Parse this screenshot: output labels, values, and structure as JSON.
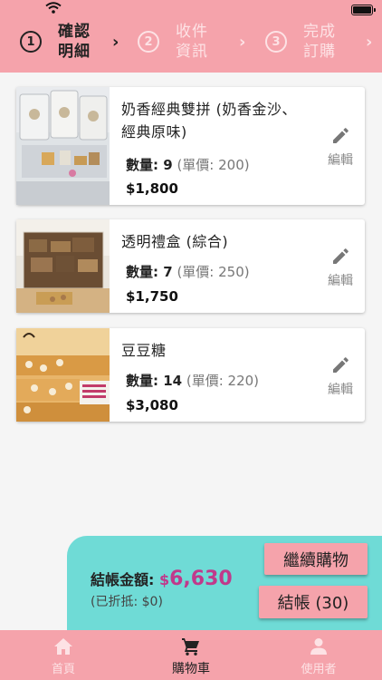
{
  "stepper": {
    "steps": [
      {
        "number": "1",
        "label": "確認\n明細",
        "active": true
      },
      {
        "number": "2",
        "label": "收件\n資訊",
        "active": false
      },
      {
        "number": "3",
        "label": "完成\n訂購",
        "active": false
      }
    ],
    "chevron": "›"
  },
  "cart": {
    "items": [
      {
        "name": "奶香經典雙拼 (奶香金沙、經典原味)",
        "qty_label": "數量: ",
        "qty": "9",
        "unit_price": " (單價: 200)",
        "price": "$1,800",
        "edit_label": "編輯",
        "icon": "pencil-icon"
      },
      {
        "name": "透明禮盒 (綜合)",
        "qty_label": "數量: ",
        "qty": "7",
        "unit_price": " (單價: 250)",
        "price": "$1,750",
        "edit_label": "編輯",
        "icon": "pencil-icon"
      },
      {
        "name": "豆豆糖",
        "qty_label": "數量: ",
        "qty": "14",
        "unit_price": " (單價: 220)",
        "price": "$3,080",
        "edit_label": "編輯",
        "icon": "pencil-icon"
      }
    ]
  },
  "checkout": {
    "total_label": "結帳金額: ",
    "currency": "$",
    "total": "6,630",
    "discount": "(已折抵: $0)",
    "continue_label": "繼續購物",
    "checkout_label": "結帳 (30)"
  },
  "nav": {
    "items": [
      {
        "label": "首頁",
        "icon": "home-icon",
        "active": false
      },
      {
        "label": "購物車",
        "icon": "cart-icon",
        "active": true
      },
      {
        "label": "使用者",
        "icon": "user-icon",
        "active": false
      }
    ]
  },
  "colors": {
    "header": "#f5a3ab",
    "checkout_panel": "#6fdbd6",
    "total_accent": "#c0398b"
  }
}
